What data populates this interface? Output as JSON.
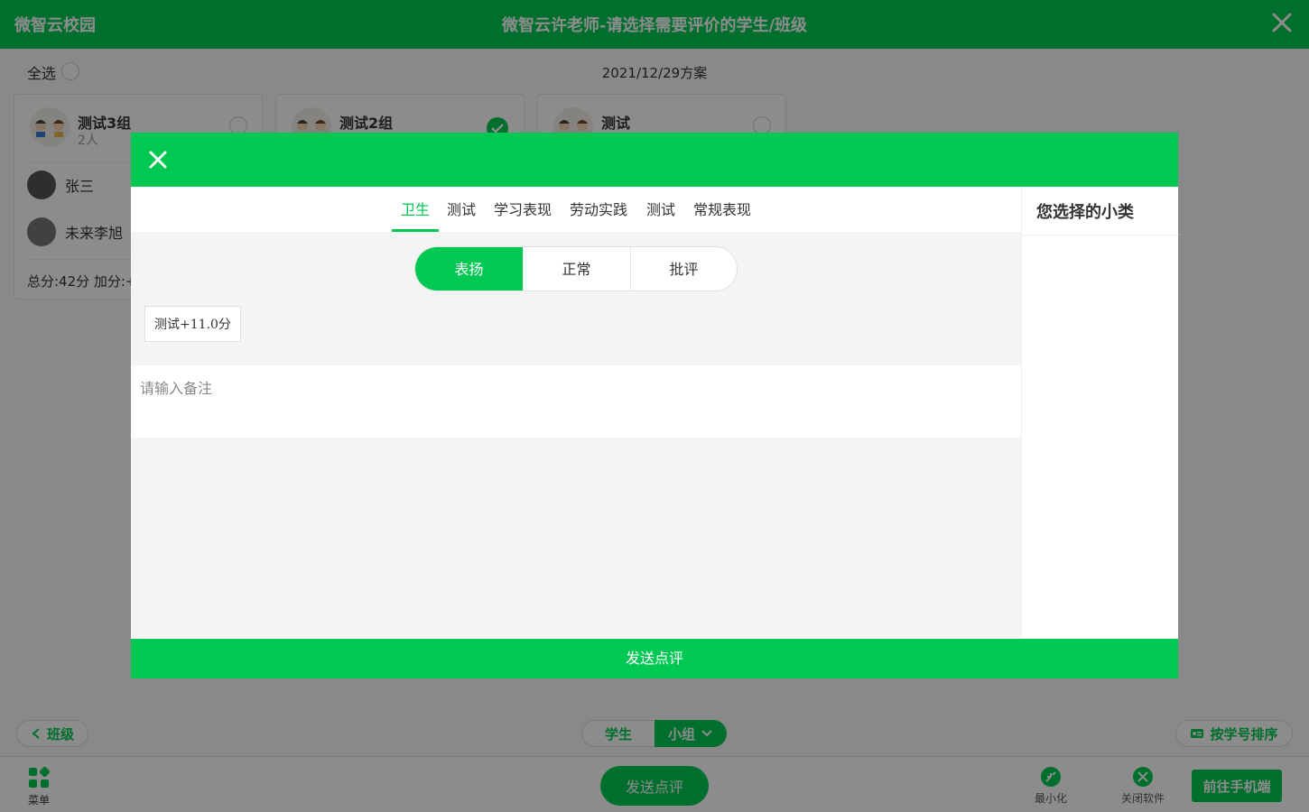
{
  "app": {
    "name": "微智云校园",
    "window_title": "微智云许老师-请选择需要评价的学生/班级"
  },
  "toolbar": {
    "select_all": "全选",
    "plan": "2021/12/29方案"
  },
  "groups": [
    {
      "name": "测试3组",
      "count": "2人",
      "selected": false,
      "members": [
        {
          "name": "张三"
        },
        {
          "name": "未来李旭"
        }
      ],
      "score": "总分:42分 加分:+"
    },
    {
      "name": "测试2组",
      "count": "",
      "selected": true
    },
    {
      "name": "测试",
      "count": "",
      "selected": false
    }
  ],
  "footer": {
    "back": "班级",
    "seg_students": "学生",
    "seg_groups": "小组",
    "sort": "按学号排序",
    "menu": "菜单",
    "send": "发送点评",
    "minimize": "最小化",
    "close_app": "关闭软件",
    "phone": "前往手机端"
  },
  "modal": {
    "tabs": [
      "卫生",
      "测试",
      "学习表现",
      "劳动实践",
      "测试",
      "常规表现"
    ],
    "active_tab": 0,
    "segments": [
      "表扬",
      "正常",
      "批评"
    ],
    "active_segment": 0,
    "items": [
      {
        "label": "测试+11.0分"
      }
    ],
    "remark_placeholder": "请输入备注",
    "side_title": "您选择的小类",
    "send": "发送点评"
  },
  "colors": {
    "primary": "#00c853"
  }
}
